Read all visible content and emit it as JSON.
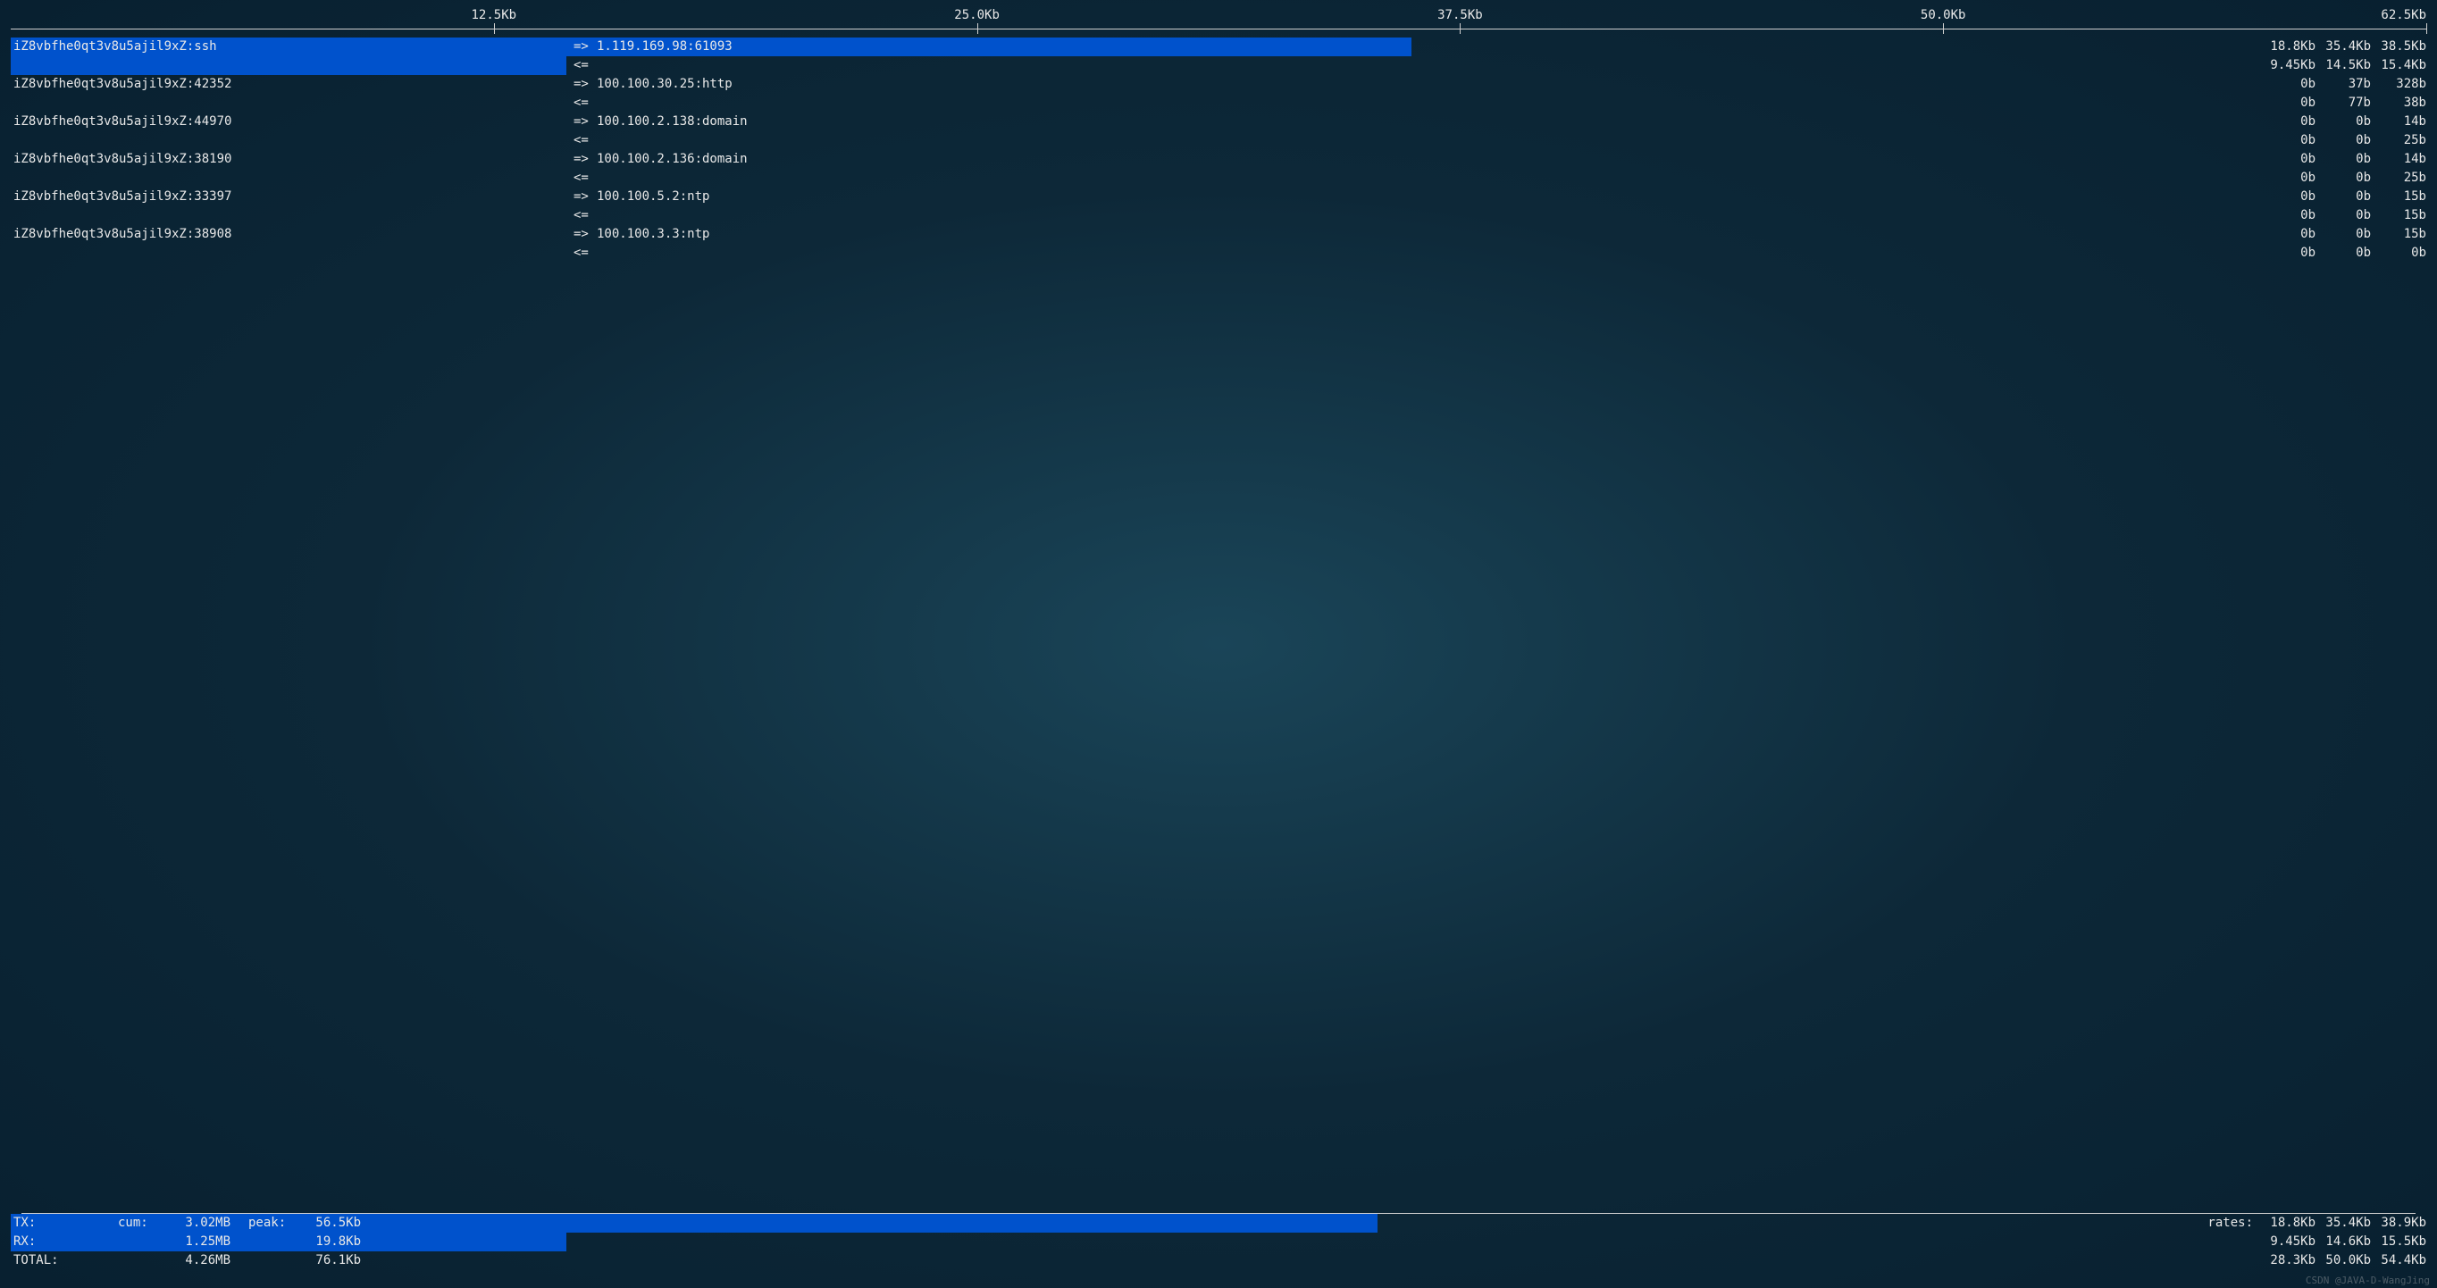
{
  "scale": {
    "ticks": [
      {
        "label": "12.5Kb",
        "pct": 20
      },
      {
        "label": "25.0Kb",
        "pct": 40
      },
      {
        "label": "37.5Kb",
        "pct": 60
      },
      {
        "label": "50.0Kb",
        "pct": 80
      },
      {
        "label": "62.5Kb",
        "pct": 100,
        "end": true
      }
    ]
  },
  "connections": [
    {
      "host": "iZ8vbfhe0qt3v8u5ajil9xZ:ssh",
      "remote": "1.119.169.98:61093",
      "tx_bar_pct": 58,
      "rx_bar_pct": 23,
      "tx": {
        "r2": "18.8Kb",
        "r10": "35.4Kb",
        "r40": "38.5Kb"
      },
      "rx": {
        "r2": "9.45Kb",
        "r10": "14.5Kb",
        "r40": "15.4Kb"
      }
    },
    {
      "host": "iZ8vbfhe0qt3v8u5ajil9xZ:42352",
      "remote": "100.100.30.25:http",
      "tx_bar_pct": 0,
      "rx_bar_pct": 0,
      "tx": {
        "r2": "0b",
        "r10": "37b",
        "r40": "328b"
      },
      "rx": {
        "r2": "0b",
        "r10": "77b",
        "r40": "38b"
      }
    },
    {
      "host": "iZ8vbfhe0qt3v8u5ajil9xZ:44970",
      "remote": "100.100.2.138:domain",
      "tx_bar_pct": 0,
      "rx_bar_pct": 0,
      "tx": {
        "r2": "0b",
        "r10": "0b",
        "r40": "14b"
      },
      "rx": {
        "r2": "0b",
        "r10": "0b",
        "r40": "25b"
      }
    },
    {
      "host": "iZ8vbfhe0qt3v8u5ajil9xZ:38190",
      "remote": "100.100.2.136:domain",
      "tx_bar_pct": 0,
      "rx_bar_pct": 0,
      "tx": {
        "r2": "0b",
        "r10": "0b",
        "r40": "14b"
      },
      "rx": {
        "r2": "0b",
        "r10": "0b",
        "r40": "25b"
      }
    },
    {
      "host": "iZ8vbfhe0qt3v8u5ajil9xZ:33397",
      "remote": "100.100.5.2:ntp",
      "tx_bar_pct": 0,
      "rx_bar_pct": 0,
      "tx": {
        "r2": "0b",
        "r10": "0b",
        "r40": "15b"
      },
      "rx": {
        "r2": "0b",
        "r10": "0b",
        "r40": "15b"
      }
    },
    {
      "host": "iZ8vbfhe0qt3v8u5ajil9xZ:38908",
      "remote": "100.100.3.3:ntp",
      "tx_bar_pct": 0,
      "rx_bar_pct": 0,
      "tx": {
        "r2": "0b",
        "r10": "0b",
        "r40": "15b"
      },
      "rx": {
        "r2": "0b",
        "r10": "0b",
        "r40": "0b"
      }
    }
  ],
  "arrows": {
    "tx": "=>",
    "rx": "<="
  },
  "summary": {
    "labels": {
      "tx": "TX:",
      "rx": "RX:",
      "total": "TOTAL:",
      "cum": "cum:",
      "peak": "peak:",
      "rates": "rates:"
    },
    "tx": {
      "cum": "3.02MB",
      "peak": "56.5Kb",
      "r2": "18.8Kb",
      "r10": "35.4Kb",
      "r40": "38.9Kb",
      "bar_pct": 56.6
    },
    "rx": {
      "cum": "1.25MB",
      "peak": "19.8Kb",
      "r2": "9.45Kb",
      "r10": "14.6Kb",
      "r40": "15.5Kb",
      "bar_pct": 23
    },
    "total": {
      "cum": "4.26MB",
      "peak": "76.1Kb",
      "r2": "28.3Kb",
      "r10": "50.0Kb",
      "r40": "54.4Kb",
      "bar_pct": 0
    }
  },
  "watermark": "CSDN @JAVA-D-WangJing"
}
